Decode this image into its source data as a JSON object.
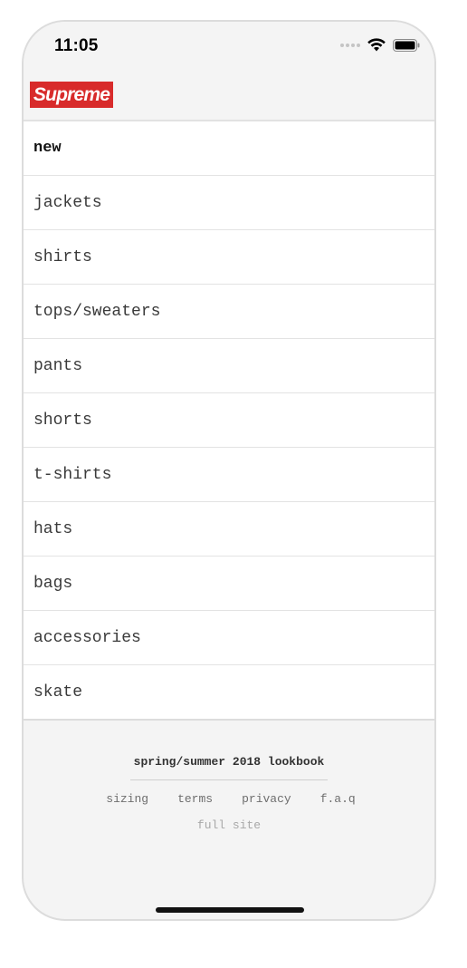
{
  "status_bar": {
    "time": "11:05",
    "icons": [
      "signal-dots-icon",
      "wifi-icon",
      "battery-icon"
    ]
  },
  "header": {
    "logo_text": "Supreme",
    "logo_color": "#d82b2b"
  },
  "menu": {
    "items": [
      {
        "label": "new",
        "bold": true
      },
      {
        "label": "jackets"
      },
      {
        "label": "shirts"
      },
      {
        "label": "tops/sweaters"
      },
      {
        "label": "pants"
      },
      {
        "label": "shorts"
      },
      {
        "label": "t-shirts"
      },
      {
        "label": "hats"
      },
      {
        "label": "bags"
      },
      {
        "label": "accessories"
      },
      {
        "label": "skate"
      }
    ]
  },
  "footer": {
    "lookbook": "spring/summer 2018 lookbook",
    "links": [
      "sizing",
      "terms",
      "privacy",
      "f.a.q"
    ],
    "full_site": "full site"
  }
}
